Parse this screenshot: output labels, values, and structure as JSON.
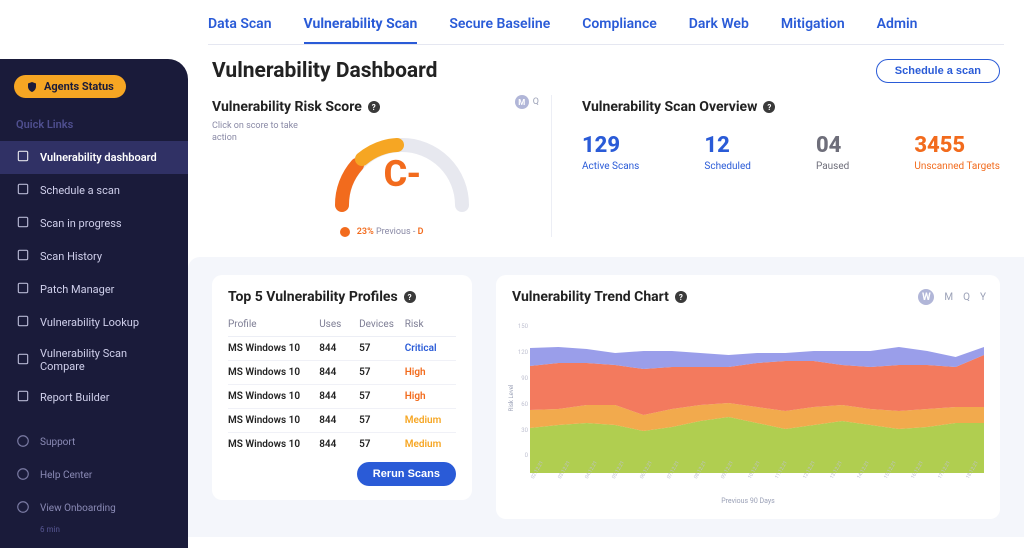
{
  "tabs": [
    "Data Scan",
    "Vulnerability Scan",
    "Secure Baseline",
    "Compliance",
    "Dark Web",
    "Mitigation",
    "Admin"
  ],
  "active_tab": 1,
  "sidebar": {
    "agents_label": "Agents Status",
    "section_label": "Quick Links",
    "items": [
      {
        "label": "Vulnerability dashboard",
        "icon": "dashboard-icon",
        "active": true
      },
      {
        "label": "Schedule a scan",
        "icon": "calendar-icon"
      },
      {
        "label": "Scan in progress",
        "icon": "progress-icon"
      },
      {
        "label": "Scan History",
        "icon": "history-icon"
      },
      {
        "label": "Patch Manager",
        "icon": "patch-icon"
      },
      {
        "label": "Vulnerability Lookup",
        "icon": "search-icon"
      },
      {
        "label": "Vulnerability Scan Compare",
        "icon": "compare-icon"
      },
      {
        "label": "Report Builder",
        "icon": "report-icon"
      }
    ],
    "bottom": [
      {
        "label": "Support",
        "icon": "support-icon"
      },
      {
        "label": "Help Center",
        "icon": "help-icon"
      },
      {
        "label": "View Onboarding",
        "icon": "onboarding-icon"
      }
    ],
    "onboarding_note": "6 min"
  },
  "page": {
    "title": "Vulnerability Dashboard",
    "schedule_btn": "Schedule a scan"
  },
  "risk": {
    "title": "Vulnerability Risk Score",
    "sub": "Click on score to take action",
    "grade": "C-",
    "pct": "23%",
    "prev_label": "Previous -",
    "prev_grade": "D",
    "range_options": [
      "M",
      "Q"
    ]
  },
  "overview": {
    "title": "Vulnerability Scan Overview",
    "stats": [
      {
        "num": "129",
        "lab": "Active Scans",
        "cls": "blue"
      },
      {
        "num": "12",
        "lab": "Scheduled",
        "cls": "blue"
      },
      {
        "num": "04",
        "lab": "Paused",
        "cls": "grey"
      },
      {
        "num": "3455",
        "lab": "Unscanned Targets",
        "cls": "red"
      }
    ]
  },
  "top5": {
    "title": "Top 5 Vulnerability Profiles",
    "cols": [
      "Profile",
      "Uses",
      "Devices",
      "Risk"
    ],
    "rows": [
      {
        "profile": "MS Windows 10",
        "uses": "844",
        "devices": "57",
        "risk": "Critical",
        "risk_cls": "risk-crit"
      },
      {
        "profile": "MS Windows 10",
        "uses": "844",
        "devices": "57",
        "risk": "High",
        "risk_cls": "risk-high"
      },
      {
        "profile": "MS Windows 10",
        "uses": "844",
        "devices": "57",
        "risk": "High",
        "risk_cls": "risk-high"
      },
      {
        "profile": "MS Windows 10",
        "uses": "844",
        "devices": "57",
        "risk": "Medium",
        "risk_cls": "risk-med"
      },
      {
        "profile": "MS Windows 10",
        "uses": "844",
        "devices": "57",
        "risk": "Medium",
        "risk_cls": "risk-med"
      }
    ],
    "btn": "Rerun Scans"
  },
  "trend": {
    "title": "Vulnerability Trend Chart",
    "range_options": [
      "W",
      "M",
      "Q",
      "Y"
    ],
    "active_range": 0,
    "x_caption": "Previous 90 Days",
    "y_label": "Risk Level"
  },
  "chart_data": {
    "type": "area",
    "x": [
      "02.12.21",
      "03.12.21",
      "04.12.21",
      "05.12.21",
      "06.12.21",
      "07.12.21",
      "08.12.21",
      "09.12.21",
      "10.12.21",
      "11.12.21",
      "12.12.21",
      "13.12.21",
      "14.12.21",
      "15.12.21",
      "16.12.21",
      "17.12.21",
      "18.12.21"
    ],
    "series": [
      {
        "name": "Green",
        "color": "#a7c93d",
        "values": [
          45,
          48,
          50,
          48,
          42,
          46,
          52,
          56,
          50,
          44,
          48,
          52,
          48,
          44,
          46,
          50,
          50
        ]
      },
      {
        "name": "Orange",
        "color": "#f1a13a",
        "values": [
          18,
          16,
          18,
          20,
          16,
          18,
          16,
          14,
          16,
          18,
          18,
          16,
          16,
          18,
          18,
          16,
          16
        ]
      },
      {
        "name": "Red",
        "color": "#f26b4d",
        "values": [
          44,
          46,
          42,
          40,
          46,
          42,
          38,
          36,
          44,
          50,
          46,
          40,
          42,
          46,
          44,
          40,
          52
        ]
      },
      {
        "name": "Blue",
        "color": "#8f94e8",
        "values": [
          18,
          16,
          14,
          12,
          18,
          16,
          14,
          12,
          10,
          8,
          10,
          14,
          16,
          18,
          14,
          10,
          8
        ]
      }
    ],
    "ylim": [
      0,
      150
    ],
    "yticks": [
      0,
      30,
      60,
      90,
      120,
      150
    ],
    "xlabel": "Previous 90 Days",
    "ylabel": "Risk Level"
  }
}
